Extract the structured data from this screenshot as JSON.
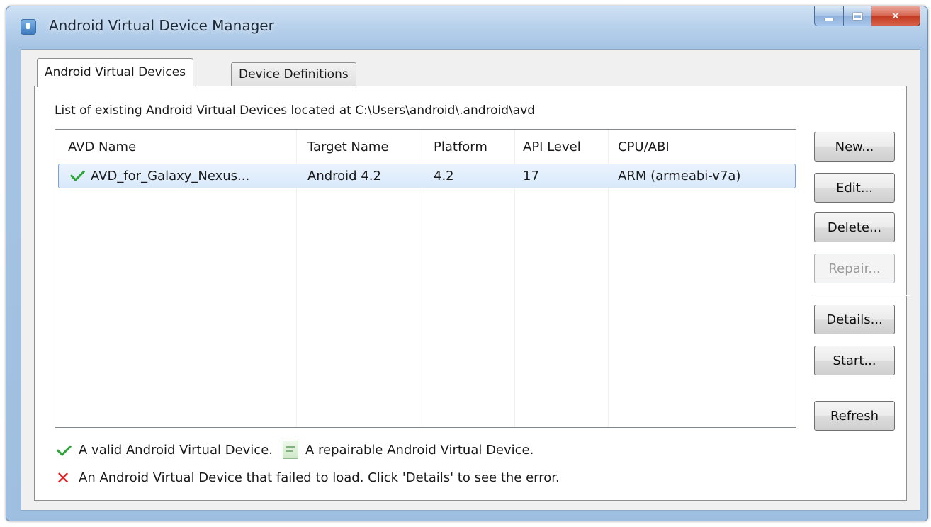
{
  "window": {
    "title": "Android Virtual Device Manager"
  },
  "tabs": [
    {
      "label": "Android Virtual Devices",
      "active": true
    },
    {
      "label": "Device Definitions",
      "active": false
    }
  ],
  "list_caption": "List of existing Android Virtual Devices located at C:\\Users\\android\\.android\\avd",
  "table": {
    "columns": [
      "AVD Name",
      "Target Name",
      "Platform",
      "API Level",
      "CPU/ABI"
    ],
    "rows": [
      {
        "status_icon": "check-icon",
        "avd_name": "AVD_for_Galaxy_Nexus...",
        "target_name": "Android 4.2",
        "platform": "4.2",
        "api_level": "17",
        "cpu_abi": "ARM (armeabi-v7a)",
        "selected": true
      }
    ]
  },
  "buttons": {
    "new": "New...",
    "edit": "Edit...",
    "delete": "Delete...",
    "repair": "Repair...",
    "details": "Details...",
    "start": "Start...",
    "refresh": "Refresh"
  },
  "legend": {
    "valid": "A valid Android Virtual Device.",
    "repairable": "A repairable Android Virtual Device.",
    "failed": "An Android Virtual Device that failed to load. Click 'Details' to see the error."
  },
  "colors": {
    "titlebar": "#b9d2ec",
    "valid_check": "#2fa33a",
    "error_x": "#e02020",
    "selection": "#d9e9fb"
  }
}
